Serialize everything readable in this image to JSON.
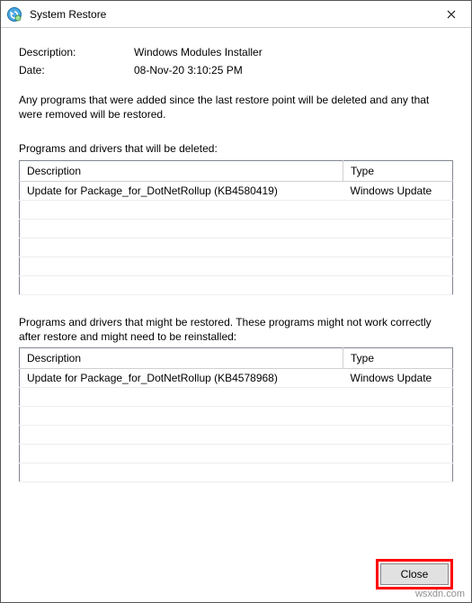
{
  "window": {
    "title": "System Restore"
  },
  "fields": {
    "description_label": "Description:",
    "description_value": "Windows Modules Installer",
    "date_label": "Date:",
    "date_value": "08-Nov-20 3:10:25 PM"
  },
  "notice": "Any programs that were added since the last restore point will be deleted and any that were removed will be restored.",
  "tables": {
    "deleted": {
      "caption": "Programs and drivers that will be deleted:",
      "headers": {
        "description": "Description",
        "type": "Type"
      },
      "rows": [
        {
          "description": "Update for Package_for_DotNetRollup (KB4580419)",
          "type": "Windows Update"
        }
      ]
    },
    "restored": {
      "caption": "Programs and drivers that might be restored. These programs might not work correctly after restore and might need to be reinstalled:",
      "headers": {
        "description": "Description",
        "type": "Type"
      },
      "rows": [
        {
          "description": "Update for Package_for_DotNetRollup (KB4578968)",
          "type": "Windows Update"
        }
      ]
    }
  },
  "buttons": {
    "close": "Close"
  },
  "watermark": "wsxdn.com"
}
